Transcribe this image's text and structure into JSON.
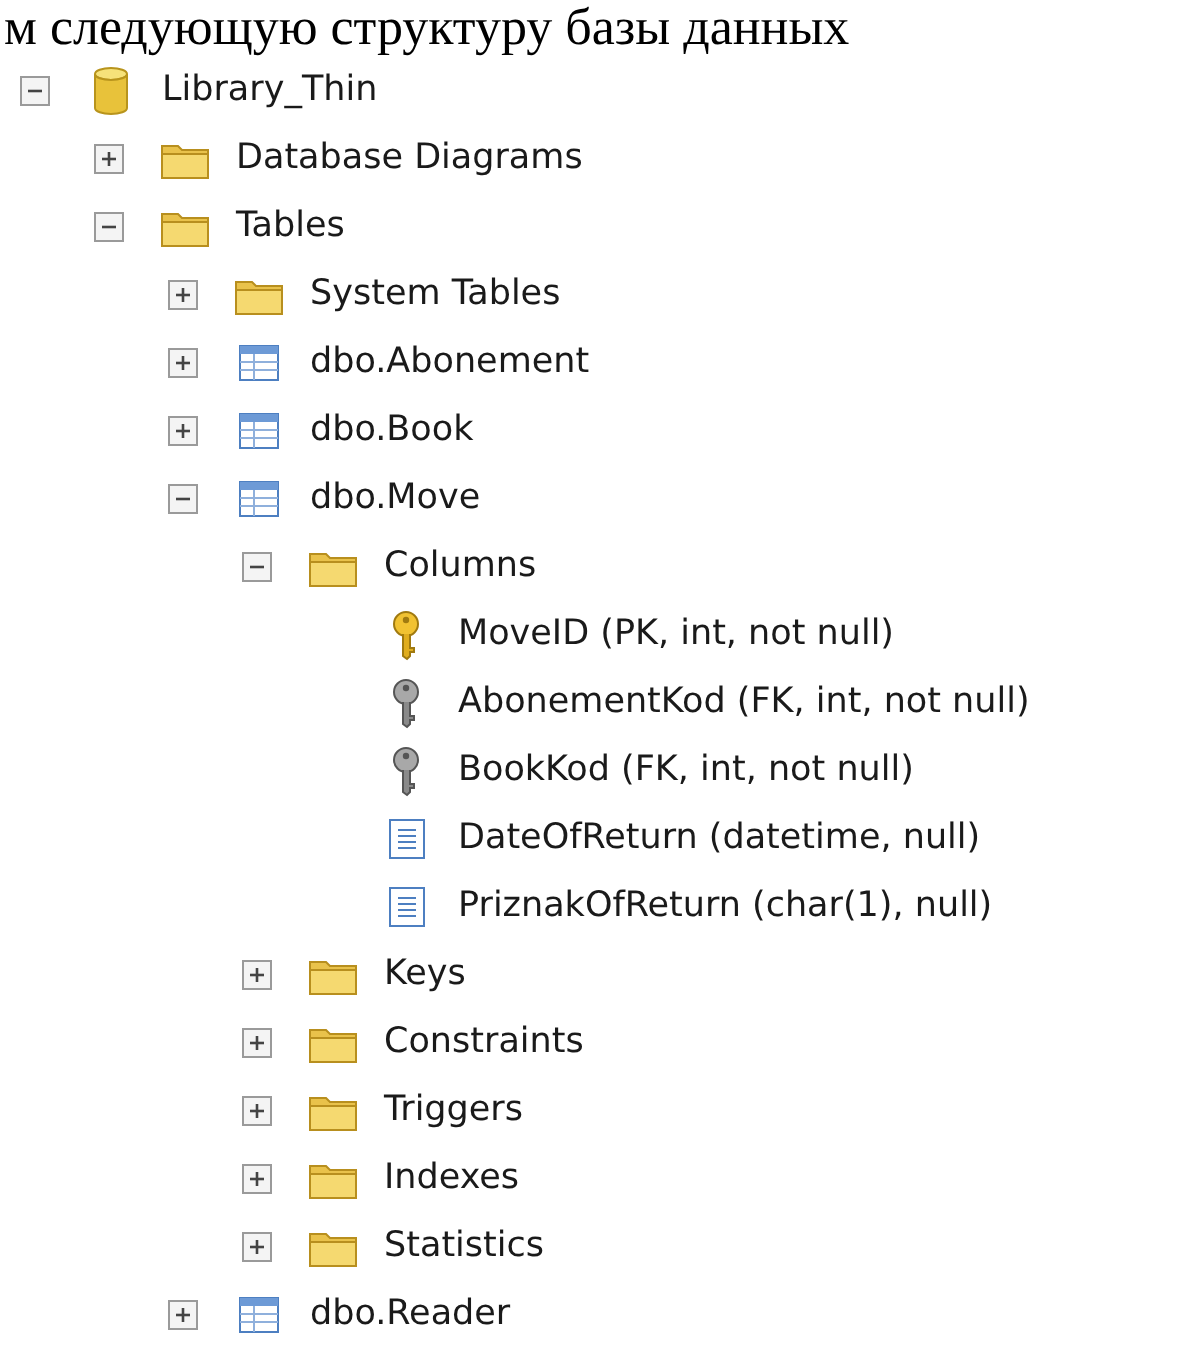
{
  "caption": "м следующую структуру базы данных",
  "tree": [
    {
      "kind": "database",
      "label": "Library_Thin",
      "expanded": true,
      "children": [
        {
          "kind": "folder",
          "label": "Database Diagrams",
          "expanded": false
        },
        {
          "kind": "folder",
          "label": "Tables",
          "expanded": true,
          "children": [
            {
              "kind": "folder",
              "label": "System Tables",
              "expanded": false
            },
            {
              "kind": "table",
              "label": "dbo.Abonement",
              "expanded": false
            },
            {
              "kind": "table",
              "label": "dbo.Book",
              "expanded": false
            },
            {
              "kind": "table",
              "label": "dbo.Move",
              "expanded": true,
              "children": [
                {
                  "kind": "folder",
                  "label": "Columns",
                  "expanded": true,
                  "children": [
                    {
                      "kind": "pk",
                      "label": "MoveID (PK, int, not null)"
                    },
                    {
                      "kind": "fk",
                      "label": "AbonementKod (FK, int, not null)"
                    },
                    {
                      "kind": "fk",
                      "label": "BookKod (FK, int, not null)"
                    },
                    {
                      "kind": "column",
                      "label": "DateOfReturn (datetime, null)"
                    },
                    {
                      "kind": "column",
                      "label": "PriznakOfReturn (char(1), null)"
                    }
                  ]
                },
                {
                  "kind": "folder",
                  "label": "Keys",
                  "expanded": false
                },
                {
                  "kind": "folder",
                  "label": "Constraints",
                  "expanded": false
                },
                {
                  "kind": "folder",
                  "label": "Triggers",
                  "expanded": false
                },
                {
                  "kind": "folder",
                  "label": "Indexes",
                  "expanded": false
                },
                {
                  "kind": "folder",
                  "label": "Statistics",
                  "expanded": false
                }
              ]
            },
            {
              "kind": "table",
              "label": "dbo.Reader",
              "expanded": false
            }
          ]
        }
      ]
    }
  ]
}
